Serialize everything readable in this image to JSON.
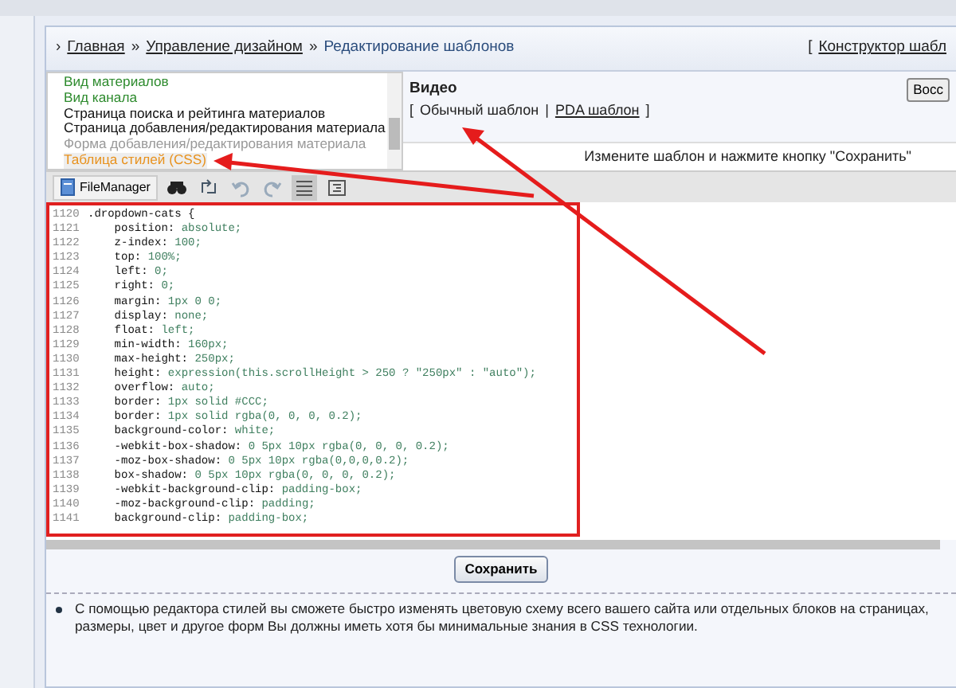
{
  "breadcrumb": [
    {
      "label": "Главная",
      "link": true
    },
    {
      "label": "Управление дизайном",
      "link": true
    },
    {
      "label": "Редактирование шаблонов",
      "link": false
    }
  ],
  "breadcrumb_marker": "›",
  "breadcrumb_separator": "»",
  "constructor_bracket": "[",
  "constructor_link": "Конструктор шабл",
  "mode_brackets": [
    "[",
    "]"
  ],
  "mode_separator": "|",
  "templates": [
    {
      "label": "Вид материалов",
      "color": "#2e8b2e",
      "selected": false
    },
    {
      "label": "Вид канала",
      "color": "#2e8b2e",
      "selected": false
    },
    {
      "label": "Страница поиска и рейтинга материалов",
      "color": "#111111",
      "selected": false
    },
    {
      "label": "Страница добавления/редактирования материала",
      "color": "#111111",
      "selected": false
    },
    {
      "label": "Форма добавления/редактирования материала",
      "color": "#999999",
      "selected": false
    },
    {
      "label": "Таблица стилей (CSS)",
      "color": "#e8921e",
      "selected": true
    }
  ],
  "section_title": "Видео",
  "template_modes": [
    {
      "label": "Обычный шаблон",
      "selected": true
    },
    {
      "label": "PDA шаблон",
      "selected": false
    }
  ],
  "restore_button": "Восс",
  "hint": "Измените шаблон и нажмите кнопку \"Сохранить\"",
  "toolbar": {
    "file_manager": "FileManager"
  },
  "code": [
    {
      "number": "1120",
      "prop": ".dropdown-cats {"
    },
    {
      "number": "1121",
      "prop": "    position:",
      "value": "absolute;"
    },
    {
      "number": "1122",
      "prop": "    z-index:",
      "value": "100;"
    },
    {
      "number": "1123",
      "prop": "    top:",
      "value": "100%;"
    },
    {
      "number": "1124",
      "prop": "    left:",
      "value": "0;"
    },
    {
      "number": "1125",
      "prop": "    right:",
      "value": "0;"
    },
    {
      "number": "1126",
      "prop": "    margin:",
      "value": "1px 0 0;"
    },
    {
      "number": "1127",
      "prop": "    display:",
      "value": "none;"
    },
    {
      "number": "1128",
      "prop": "    float:",
      "value": "left;"
    },
    {
      "number": "1129",
      "prop": "    min-width:",
      "value": "160px;"
    },
    {
      "number": "1130",
      "prop": "    max-height:",
      "value": "250px;"
    },
    {
      "number": "1131",
      "prop": "    height:",
      "value": "expression(this.scrollHeight > 250 ? \"250px\" : \"auto\");"
    },
    {
      "number": "1132",
      "prop": "    overflow:",
      "value": "auto;"
    },
    {
      "number": "1133",
      "prop": "    border:",
      "value": "1px solid #CCC;"
    },
    {
      "number": "1134",
      "prop": "    border:",
      "value": "1px solid rgba(0, 0, 0, 0.2);"
    },
    {
      "number": "1135",
      "prop": "    background-color:",
      "value": "white;"
    },
    {
      "number": "1136",
      "prop": "    -webkit-box-shadow:",
      "value": "0 5px 10px rgba(0, 0, 0, 0.2);"
    },
    {
      "number": "1137",
      "prop": "    -moz-box-shadow:",
      "value": "0 5px 10px rgba(0,0,0,0.2);"
    },
    {
      "number": "1138",
      "prop": "    box-shadow:",
      "value": "0 5px 10px rgba(0, 0, 0, 0.2);"
    },
    {
      "number": "1139",
      "prop": "    -webkit-background-clip:",
      "value": "padding-box;"
    },
    {
      "number": "1140",
      "prop": "    -moz-background-clip:",
      "value": "padding;"
    },
    {
      "number": "1141",
      "prop": "    background-clip:",
      "value": "padding-box;"
    }
  ],
  "save_button": "Сохранить",
  "note": "С помощью редактора стилей вы сможете быстро изменять цветовую схему всего вашего сайта или отдельных блоков на страницах, размеры, цвет и другое форм Вы должны иметь хотя бы минимальные знания в CSS технологии."
}
